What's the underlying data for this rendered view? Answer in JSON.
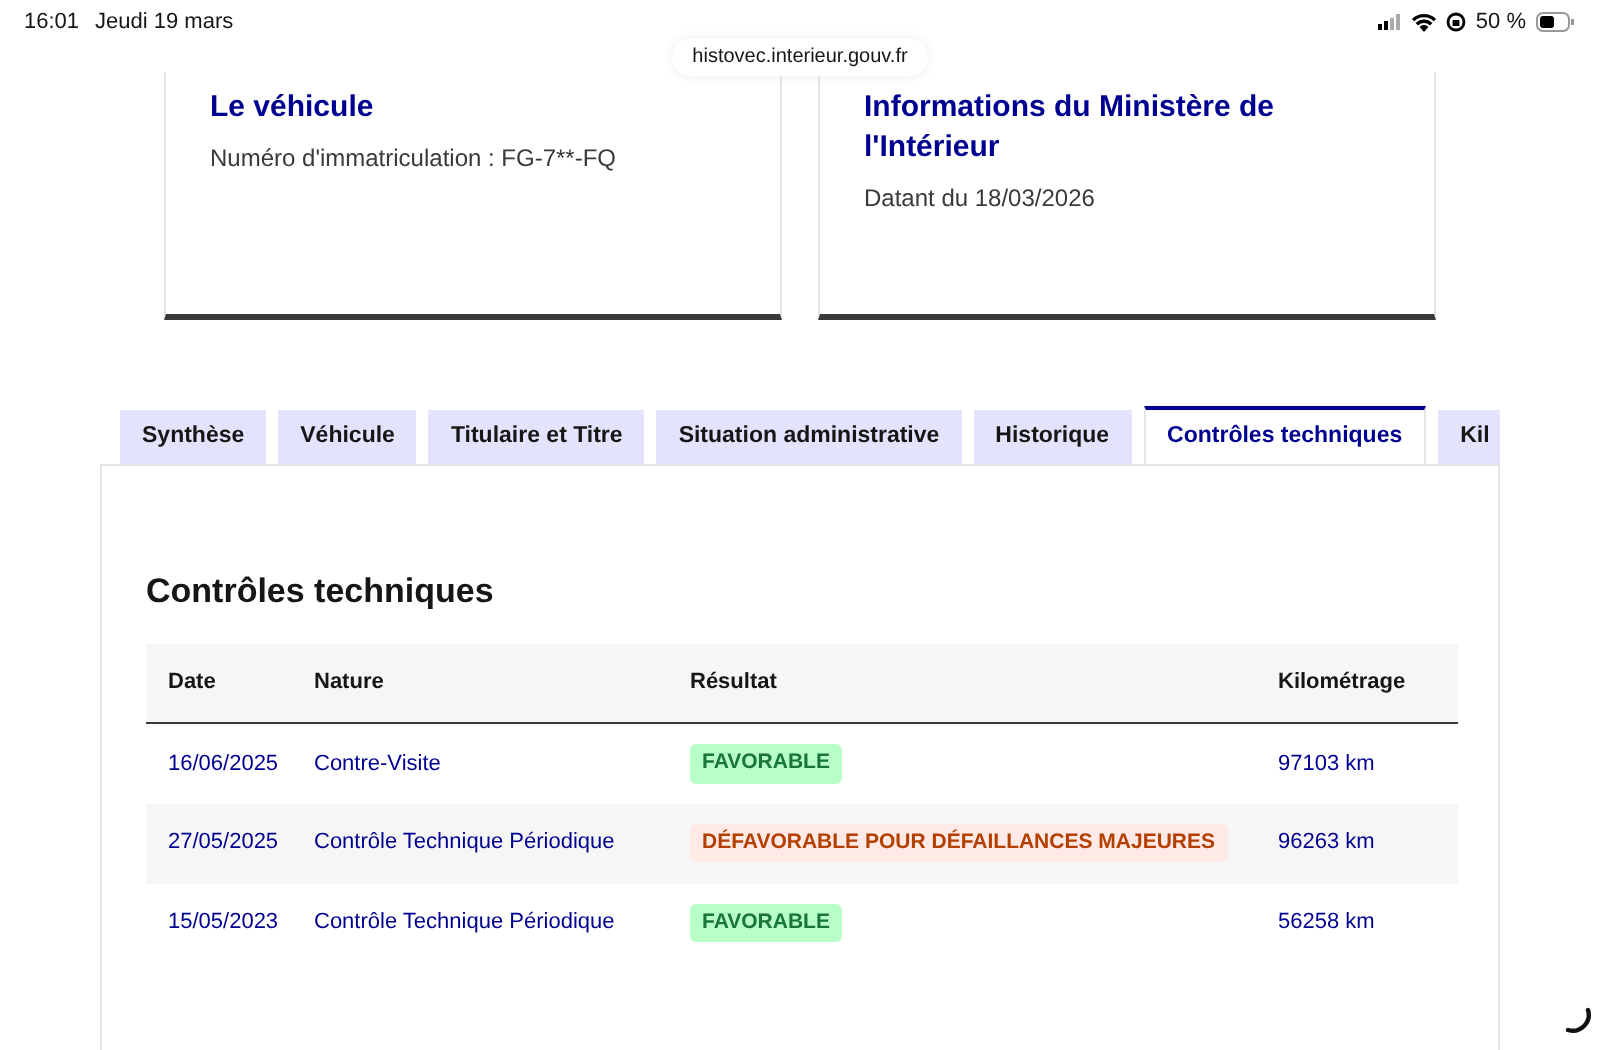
{
  "status_bar": {
    "time": "16:01",
    "date": "Jeudi 19 mars",
    "battery": "50 %"
  },
  "url": "histovec.interieur.gouv.fr",
  "cards": [
    {
      "title": "Le véhicule",
      "text": "Numéro d'immatriculation : FG-7**-FQ"
    },
    {
      "title": "Informations du Ministère de l'Intérieur",
      "text": "Datant du 18/03/2026"
    }
  ],
  "tabs": [
    {
      "label": "Synthèse",
      "selected": false
    },
    {
      "label": "Véhicule",
      "selected": false
    },
    {
      "label": "Titulaire et Titre",
      "selected": false
    },
    {
      "label": "Situation administrative",
      "selected": false
    },
    {
      "label": "Historique",
      "selected": false
    },
    {
      "label": "Contrôles techniques",
      "selected": true
    },
    {
      "label": "Kil",
      "selected": false
    }
  ],
  "section_title": "Contrôles techniques",
  "table": {
    "columns": [
      "Date",
      "Nature",
      "Résultat",
      "Kilométrage"
    ],
    "rows": [
      {
        "date": "16/06/2025",
        "nature": "Contre-Visite",
        "result": "FAVORABLE",
        "kind": "favorable",
        "mileage": "97103 km"
      },
      {
        "date": "27/05/2025",
        "nature": "Contrôle Technique Périodique",
        "result": "DÉFAVORABLE POUR DÉFAILLANCES MAJEURES",
        "kind": "defavorable",
        "mileage": "96263 km"
      },
      {
        "date": "15/05/2023",
        "nature": "Contrôle Technique Périodique",
        "result": "FAVORABLE",
        "kind": "favorable",
        "mileage": "56258 km"
      }
    ]
  }
}
